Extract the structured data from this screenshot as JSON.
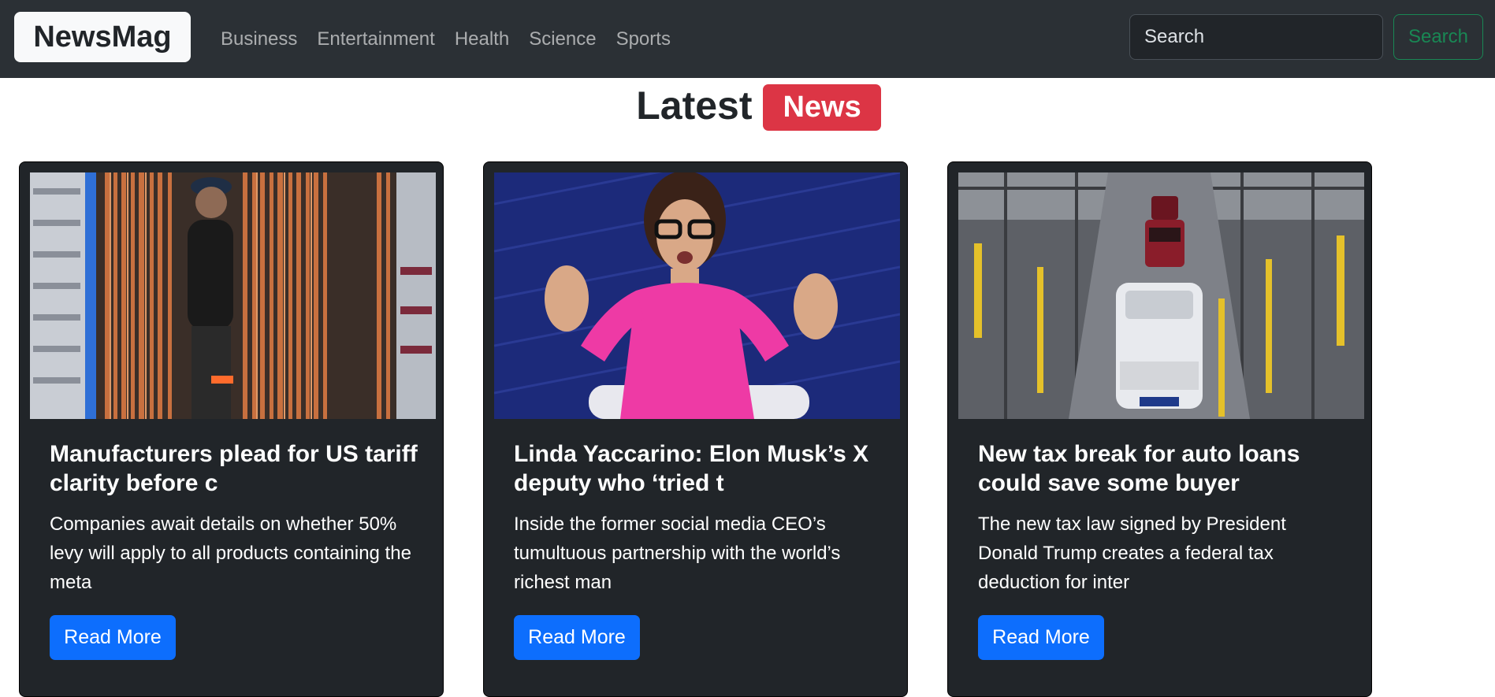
{
  "nav": {
    "brand": "NewsMag",
    "links": [
      "Business",
      "Entertainment",
      "Health",
      "Science",
      "Sports"
    ],
    "search_placeholder": "Search",
    "search_button": "Search"
  },
  "heading": {
    "text": "Latest",
    "badge": "News"
  },
  "cards": [
    {
      "title": "Manufacturers plead for US tariff clarity before c",
      "description": "Companies await details on whether 50% levy will apply to all products containing the meta",
      "button": "Read More"
    },
    {
      "title": "Linda Yaccarino: Elon Musk’s X deputy who ‘tried t",
      "description": "Inside the former social media CEO’s tumultuous partnership with the world’s richest man",
      "button": "Read More"
    },
    {
      "title": "New tax break for auto loans could save some buyer",
      "description": "The new tax law signed by President Donald Trump creates a federal tax deduction for inter",
      "button": "Read More"
    }
  ],
  "colors": {
    "navbar": "#2b3035",
    "card": "#212529",
    "badge": "#dc3545",
    "primary": "#0d6efd",
    "success": "#198754"
  }
}
